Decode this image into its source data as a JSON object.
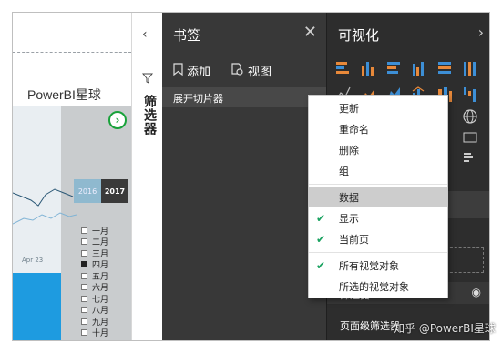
{
  "canvas": {
    "report_title": "PowerBI星球",
    "year_buttons": [
      "2016",
      "2017"
    ],
    "axis_label": "Apr 23",
    "months": [
      {
        "label": "一月",
        "checked": false
      },
      {
        "label": "二月",
        "checked": false
      },
      {
        "label": "三月",
        "checked": false
      },
      {
        "label": "四月",
        "checked": true
      },
      {
        "label": "五月",
        "checked": false
      },
      {
        "label": "六月",
        "checked": false
      },
      {
        "label": "七月",
        "checked": false
      },
      {
        "label": "八月",
        "checked": false
      },
      {
        "label": "九月",
        "checked": false
      },
      {
        "label": "十月",
        "checked": false
      }
    ]
  },
  "filters_rail": {
    "collapse_glyph": "‹",
    "label": "筛选器"
  },
  "bookmarks": {
    "title": "书签",
    "add_label": "添加",
    "view_label": "视图",
    "items": [
      {
        "label": "展开切片器",
        "more": "..."
      }
    ]
  },
  "visualizations": {
    "title": "可视化",
    "filters_label": "筛选器",
    "page_filters_label": "页面级筛选器"
  },
  "context_menu": {
    "items": [
      {
        "label": "更新",
        "checked": false,
        "hover": false
      },
      {
        "label": "重命名",
        "checked": false,
        "hover": false
      },
      {
        "label": "删除",
        "checked": false,
        "hover": false
      },
      {
        "label": "组",
        "checked": false,
        "hover": false
      },
      {
        "label": "数据",
        "checked": false,
        "hover": true
      },
      {
        "label": "显示",
        "checked": true,
        "hover": false
      },
      {
        "label": "当前页",
        "checked": true,
        "hover": false
      },
      {
        "label": "所有视觉对象",
        "checked": true,
        "hover": false
      },
      {
        "label": "所选的视觉对象",
        "checked": false,
        "hover": false
      }
    ]
  },
  "watermark": "知乎 @PowerBI星球",
  "colors": {
    "accent_check": "#1aa260",
    "highlight_circle": "#18a23a",
    "pane_dark": "#383838",
    "viz_dark": "#2d2d2d"
  }
}
